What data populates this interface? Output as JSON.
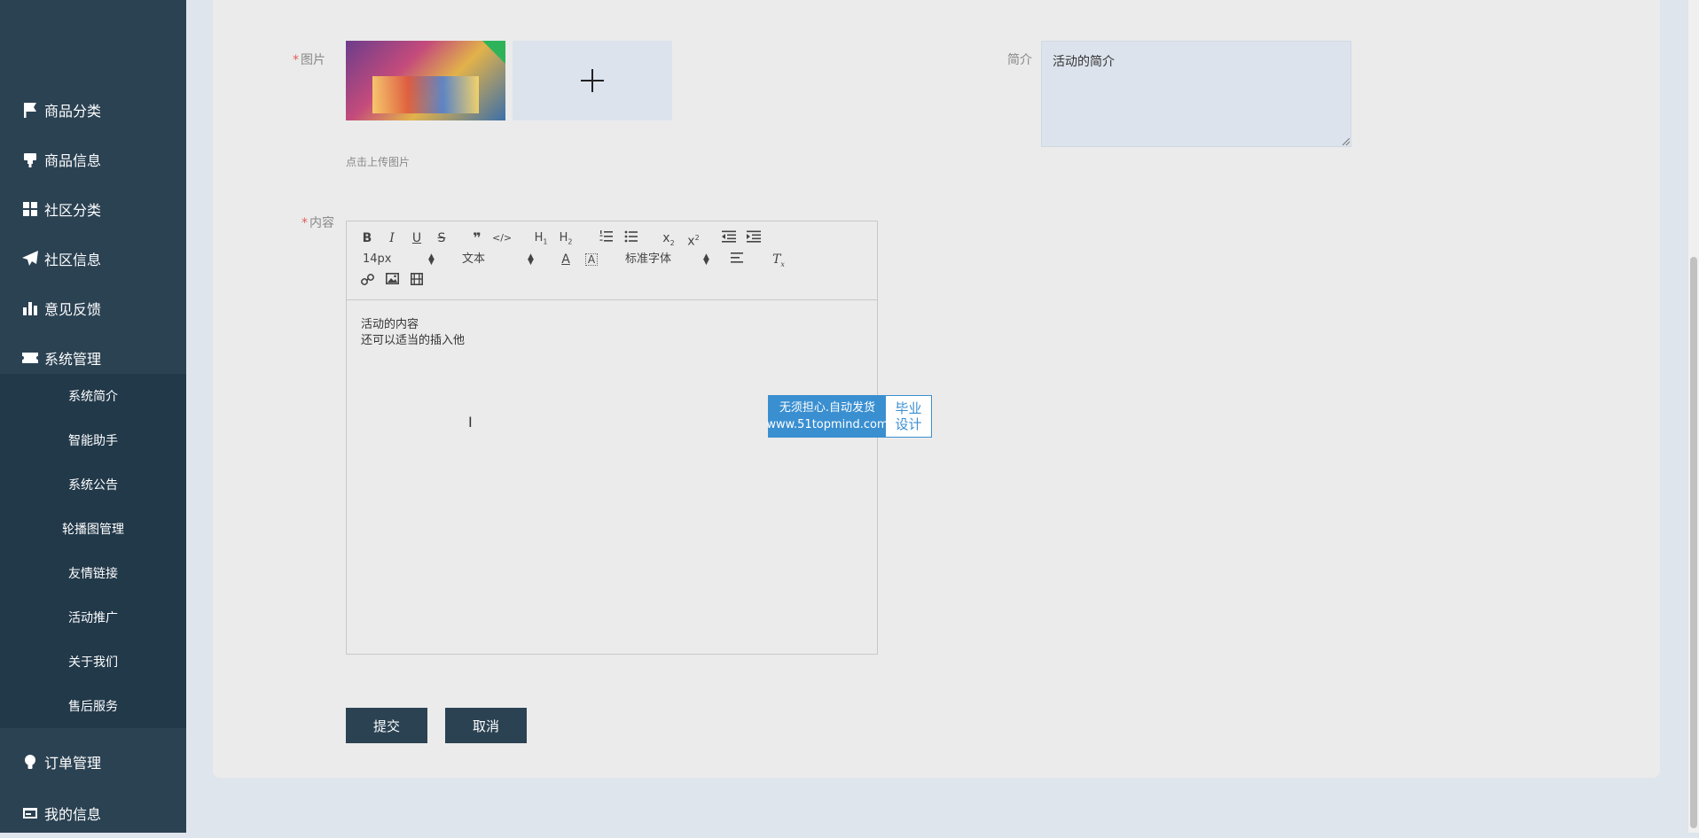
{
  "sidebar": {
    "items": [
      {
        "label": "商品分类",
        "icon": "flag-icon"
      },
      {
        "label": "商品信息",
        "icon": "stamp-icon"
      },
      {
        "label": "社区分类",
        "icon": "grid-icon"
      },
      {
        "label": "社区信息",
        "icon": "paper-plane-icon"
      },
      {
        "label": "意见反馈",
        "icon": "bar-chart-icon"
      },
      {
        "label": "系统管理",
        "icon": "ticket-icon"
      }
    ],
    "submenu": [
      "系统简介",
      "智能助手",
      "系统公告",
      "轮播图管理",
      "友情链接",
      "活动推广",
      "关于我们",
      "售后服务"
    ],
    "bottom_items": [
      {
        "label": "订单管理",
        "icon": "bulb-icon"
      },
      {
        "label": "我的信息",
        "icon": "card-icon"
      }
    ]
  },
  "form": {
    "image_label": "图片",
    "upload_hint": "点击上传图片",
    "intro_label": "简介",
    "intro_value": "活动的简介",
    "content_label": "内容",
    "required_mark": "*",
    "submit_label": "提交",
    "cancel_label": "取消"
  },
  "editor": {
    "font_size": "14px",
    "header_select": "文本",
    "font_family": "标准字体",
    "content_lines": [
      "活动的内容",
      "还可以适当的插入他"
    ]
  },
  "watermark": {
    "line1": "无须担心.自动发货",
    "line2": "www.51topmind.com",
    "right1": "毕业",
    "right2": "设计"
  },
  "colors": {
    "sidebar": "#2b4253",
    "submenu": "#22394a",
    "accent": "#3a8fd1",
    "required": "#e25b5b"
  }
}
